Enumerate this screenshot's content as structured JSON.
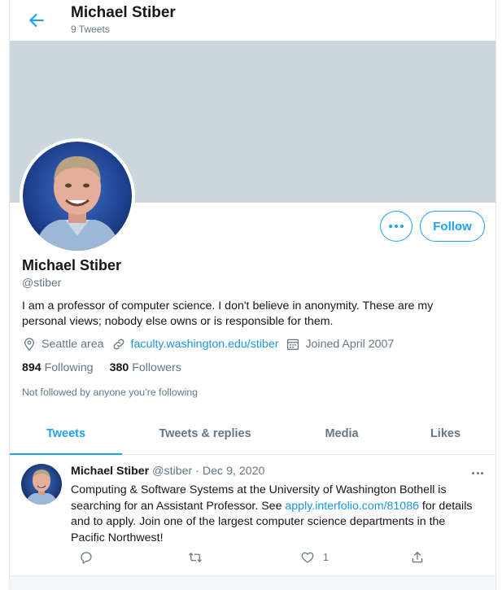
{
  "header": {
    "back_icon": "arrow-left-icon",
    "name": "Michael Stiber",
    "tweet_count": "9 Tweets"
  },
  "profile": {
    "name": "Michael Stiber",
    "handle": "@stiber",
    "bio": "I am a professor of computer science. I don't believe in anonymity. These are my personal views; nobody else owns or is responsible for them.",
    "location": "Seattle area",
    "website": "faculty.washington.edu/stiber",
    "joined": "Joined April 2007",
    "following_count": "894",
    "following_label": "Following",
    "followers_count": "380",
    "followers_label": "Followers",
    "not_followed_text": "Not followed by anyone you’re following",
    "follow_label": "Follow",
    "more_icon": "more-horizontal-icon"
  },
  "tabs": [
    {
      "label": "Tweets",
      "active": true
    },
    {
      "label": "Tweets & replies",
      "active": false
    },
    {
      "label": "Media",
      "active": false
    },
    {
      "label": "Likes",
      "active": false
    }
  ],
  "tweet": {
    "author": "Michael Stiber",
    "handle": "@stiber",
    "separator": "·",
    "date": "Dec 9, 2020",
    "text_before": "Computing & Software Systems at the University of Washington Bothell is searching for an Assistant Professor. See ",
    "link": "apply.interfolio.com/81086",
    "text_after": " for details and to apply. Join one of the largest computer science departments in the Pacific Northwest!",
    "reply_count": "",
    "retweet_count": "",
    "like_count": "1"
  },
  "colors": {
    "accent": "#1da1f2",
    "link": "#1b95e0",
    "banner": "#ccd6dd",
    "secondary_text": "#657786"
  }
}
